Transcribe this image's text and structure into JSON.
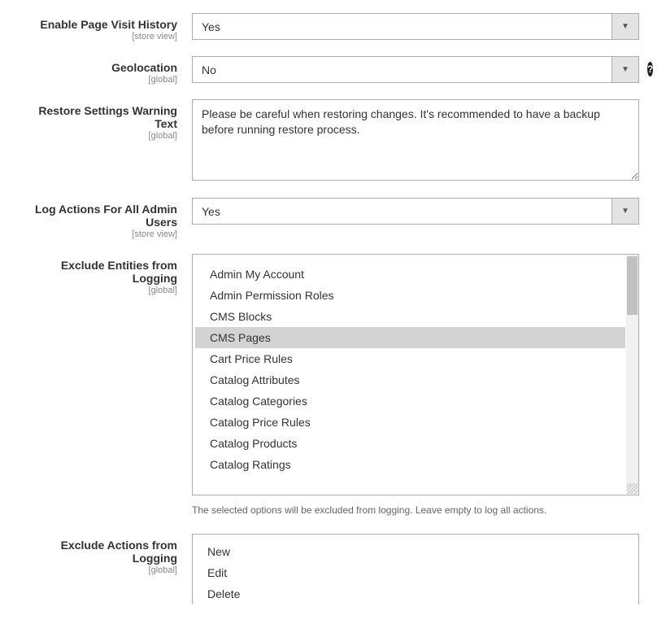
{
  "scope": {
    "store_view": "[store view]",
    "global": "[global]"
  },
  "fields": {
    "history": {
      "label": "Enable Page Visit History",
      "scope": "store_view",
      "value": "Yes"
    },
    "geo": {
      "label": "Geolocation",
      "scope": "global",
      "value": "No"
    },
    "restore": {
      "label": "Restore Settings Warning Text",
      "scope": "global",
      "value": "Please be careful when restoring changes. It's recommended to have a backup before running restore process."
    },
    "logall": {
      "label": "Log Actions For All Admin Users",
      "scope": "store_view",
      "value": "Yes"
    },
    "excl_entities": {
      "label": "Exclude Entities from Logging",
      "scope": "global",
      "options": [
        "Admin My Account",
        "Admin Permission Roles",
        "CMS Blocks",
        "CMS Pages",
        "Cart Price Rules",
        "Catalog Attributes",
        "Catalog Categories",
        "Catalog Price Rules",
        "Catalog Products",
        "Catalog Ratings"
      ],
      "selected_index": 3,
      "helptext": "The selected options will be excluded from logging. Leave empty to log all actions."
    },
    "excl_actions": {
      "label": "Exclude Actions from Logging",
      "scope": "global",
      "options": [
        "New",
        "Edit",
        "Delete"
      ]
    }
  },
  "glyph": {
    "chev": "▼",
    "question": "?"
  }
}
